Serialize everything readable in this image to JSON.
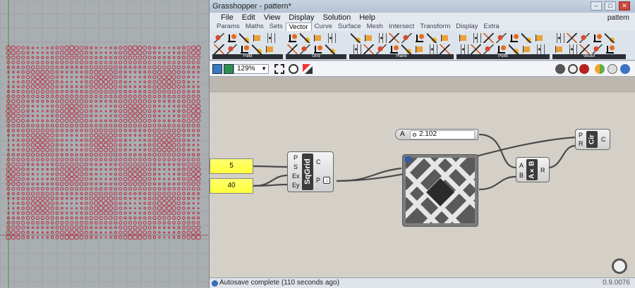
{
  "window": {
    "title": "Grasshopper - pattern*",
    "doc_name": "pattern"
  },
  "menu": [
    "File",
    "Edit",
    "View",
    "Display",
    "Solution",
    "Help"
  ],
  "tabs": [
    "Params",
    "Maths",
    "Sets",
    "Vector",
    "Curve",
    "Surface",
    "Mesh",
    "Intersect",
    "Transform",
    "Display",
    "Extra"
  ],
  "active_tab": "Vector",
  "ribbon_groups": [
    "Field",
    "Grid",
    "Plane",
    "Point",
    "Vector"
  ],
  "toolbar": {
    "zoom": "129%"
  },
  "canvas": {
    "panel_a": "5",
    "panel_b": "40",
    "sqgrid": {
      "name": "SqGrid",
      "inputs": [
        "P",
        "S",
        "Ex",
        "Ey"
      ],
      "outputs": [
        "C",
        "P"
      ]
    },
    "slider": {
      "label": "A",
      "value": "2.102"
    },
    "multiply": {
      "name": "A×B",
      "inputs": [
        "A",
        "B"
      ],
      "output": "R"
    },
    "circle": {
      "name": "Cir",
      "inputs": [
        "P",
        "R"
      ],
      "output": "C"
    }
  },
  "status": {
    "text": "Autosave complete (110 seconds ago)",
    "version": "0.9.0076"
  },
  "colors": {
    "panel_yellow": "#ffff44",
    "viewport_points": "#c0203a",
    "canvas_bg": "#d4d0c8"
  }
}
